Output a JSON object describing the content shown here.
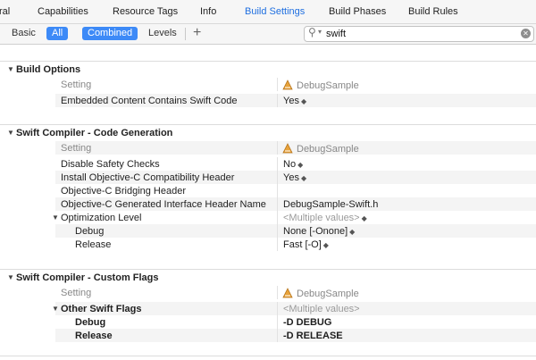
{
  "tabs": [
    {
      "label": "ral",
      "active": false
    },
    {
      "label": "Capabilities",
      "active": false
    },
    {
      "label": "Resource Tags",
      "active": false
    },
    {
      "label": "Info",
      "active": false
    },
    {
      "label": "Build Settings",
      "active": true
    },
    {
      "label": "Build Phases",
      "active": false
    },
    {
      "label": "Build Rules",
      "active": false
    }
  ],
  "filter": {
    "basic": "Basic",
    "all": "All",
    "combined": "Combined",
    "levels": "Levels",
    "add": "+"
  },
  "search": {
    "value": "swift"
  },
  "target_name": "DebugSample",
  "sections": {
    "build_options": {
      "title": "Build Options",
      "setting_header": "Setting",
      "rows": [
        {
          "label": "Embedded Content Contains Swift Code",
          "value": "Yes"
        }
      ]
    },
    "codegen": {
      "title": "Swift Compiler - Code Generation",
      "setting_header": "Setting",
      "rows": [
        {
          "label": "Disable Safety Checks",
          "value": "No"
        },
        {
          "label": "Install Objective-C Compatibility Header",
          "value": "Yes"
        },
        {
          "label": "Objective-C Bridging Header",
          "value": ""
        },
        {
          "label": "Objective-C Generated Interface Header Name",
          "value": "DebugSample-Swift.h"
        },
        {
          "label": "Optimization Level",
          "value": "<Multiple values>"
        },
        {
          "label": "Debug",
          "value": "None [-Onone]"
        },
        {
          "label": "Release",
          "value": "Fast [-O]"
        }
      ]
    },
    "custom_flags": {
      "title": "Swift Compiler - Custom Flags",
      "setting_header": "Setting",
      "rows": [
        {
          "label": "Other Swift Flags",
          "value": "<Multiple values>"
        },
        {
          "label": "Debug",
          "value": "-D DEBUG"
        },
        {
          "label": "Release",
          "value": "-D RELEASE"
        }
      ]
    }
  },
  "colors": {
    "accent": "#3d8af7",
    "active_tab": "#1f6fe0",
    "row_alt": "#f4f4f4"
  }
}
